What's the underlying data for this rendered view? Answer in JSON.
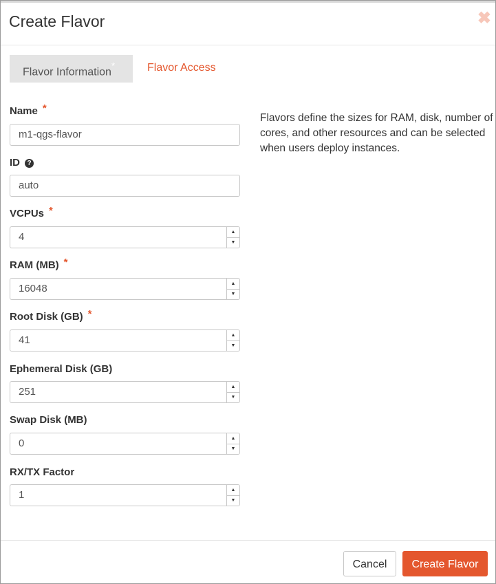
{
  "modal": {
    "title": "Create Flavor",
    "close_symbol": "✖"
  },
  "tabs": [
    {
      "label": "Flavor Information",
      "marker": "*",
      "active": true
    },
    {
      "label": "Flavor Access",
      "active": false
    }
  ],
  "fields": {
    "name": {
      "label": "Name",
      "required": "*",
      "value": "m1-qgs-flavor"
    },
    "id": {
      "label": "ID",
      "help_icon": "?",
      "value": "auto"
    },
    "vcpus": {
      "label": "VCPUs",
      "required": "*",
      "value": "4"
    },
    "ram": {
      "label": "RAM (MB)",
      "required": "*",
      "value": "16048"
    },
    "root_disk": {
      "label": "Root Disk (GB)",
      "required": "*",
      "value": "41"
    },
    "ephemeral_disk": {
      "label": "Ephemeral Disk (GB)",
      "value": "251"
    },
    "swap_disk": {
      "label": "Swap Disk (MB)",
      "value": "0"
    },
    "rxtx_factor": {
      "label": "RX/TX Factor",
      "value": "1"
    }
  },
  "spinner": {
    "up": "▲",
    "down": "▼"
  },
  "description": "Flavors define the sizes for RAM, disk, number of cores, and other resources and can be selected when users deploy instances.",
  "footer": {
    "cancel_label": "Cancel",
    "create_label": "Create Flavor"
  },
  "colors": {
    "accent": "#e4572e",
    "tab_active_bg": "#e4e4e4"
  }
}
